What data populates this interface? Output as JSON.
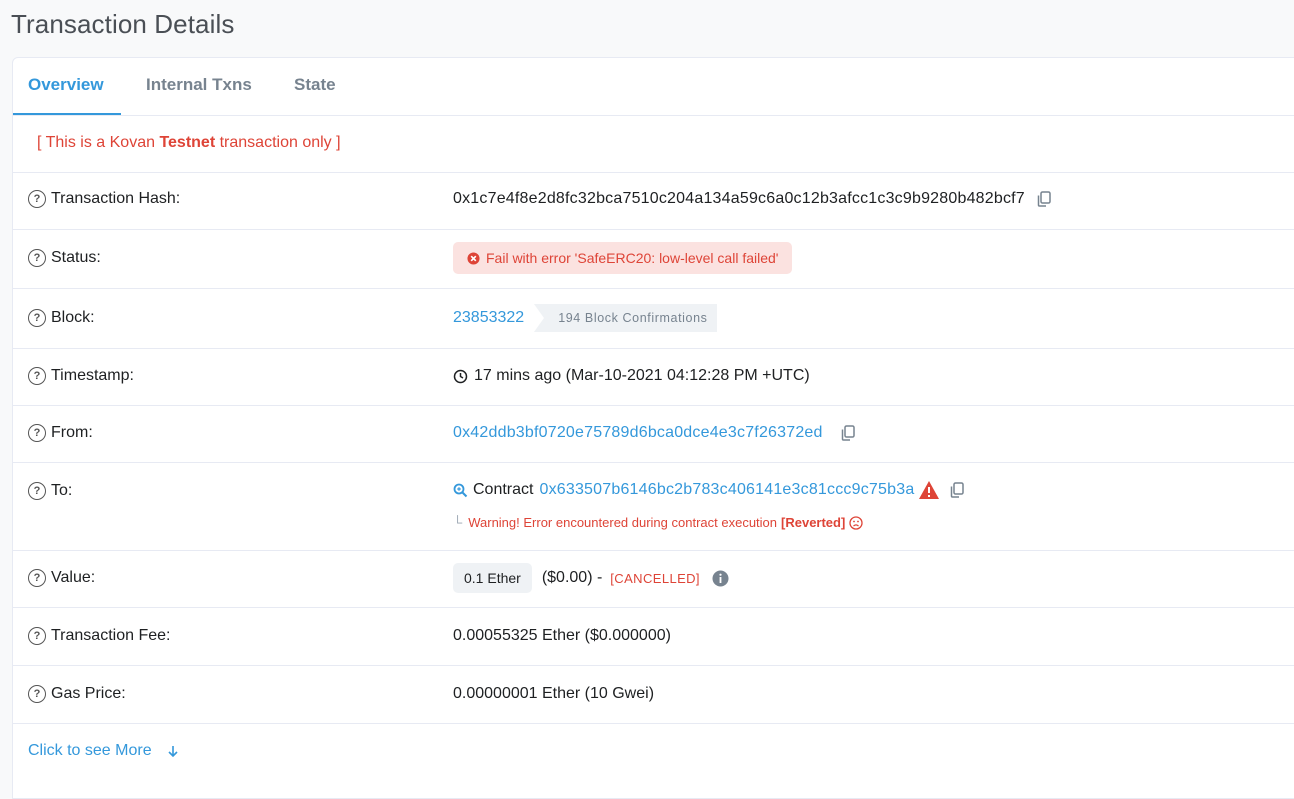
{
  "page": {
    "title": "Transaction Details"
  },
  "tabs": [
    {
      "label": "Overview"
    },
    {
      "label": "Internal Txns"
    },
    {
      "label": "State"
    }
  ],
  "notice": {
    "open": "[ This is a Kovan ",
    "strong": "Testnet",
    "close": " transaction only ]"
  },
  "details": {
    "hash": {
      "label": "Transaction Hash:",
      "value": "0x1c7e4f8e2d8fc32bca7510c204a134a59c6a0c12b3afcc1c3c9b9280b482bcf7"
    },
    "status": {
      "label": "Status:",
      "value": "Fail with error 'SafeERC20: low-level call failed'"
    },
    "block": {
      "label": "Block:",
      "number": "23853322",
      "confirmations": "194 Block Confirmations"
    },
    "timestamp": {
      "label": "Timestamp:",
      "value": "17 mins ago (Mar-10-2021 04:12:28 PM +UTC)"
    },
    "from": {
      "label": "From:",
      "address": "0x42ddb3bf0720e75789d6bca0dce4e3c7f26372ed"
    },
    "to": {
      "label": "To:",
      "prefix": "Contract",
      "address": "0x633507b6146bc2b783c406141e3c81ccc9c75b3a",
      "warning_text": "Warning! Error encountered during contract execution ",
      "warning_tag": "[Reverted]"
    },
    "value": {
      "label": "Value:",
      "amount": "0.1 Ether",
      "usd": "($0.00) -",
      "tag": "[CANCELLED]"
    },
    "fee": {
      "label": "Transaction Fee:",
      "value": "0.00055325 Ether ($0.000000)"
    },
    "gas": {
      "label": "Gas Price:",
      "value": "0.00000001 Ether (10 Gwei)"
    }
  },
  "more": {
    "label": "Click to see More"
  },
  "colors": {
    "accent": "#3498db",
    "danger": "#de4437",
    "muted": "#77838f"
  }
}
